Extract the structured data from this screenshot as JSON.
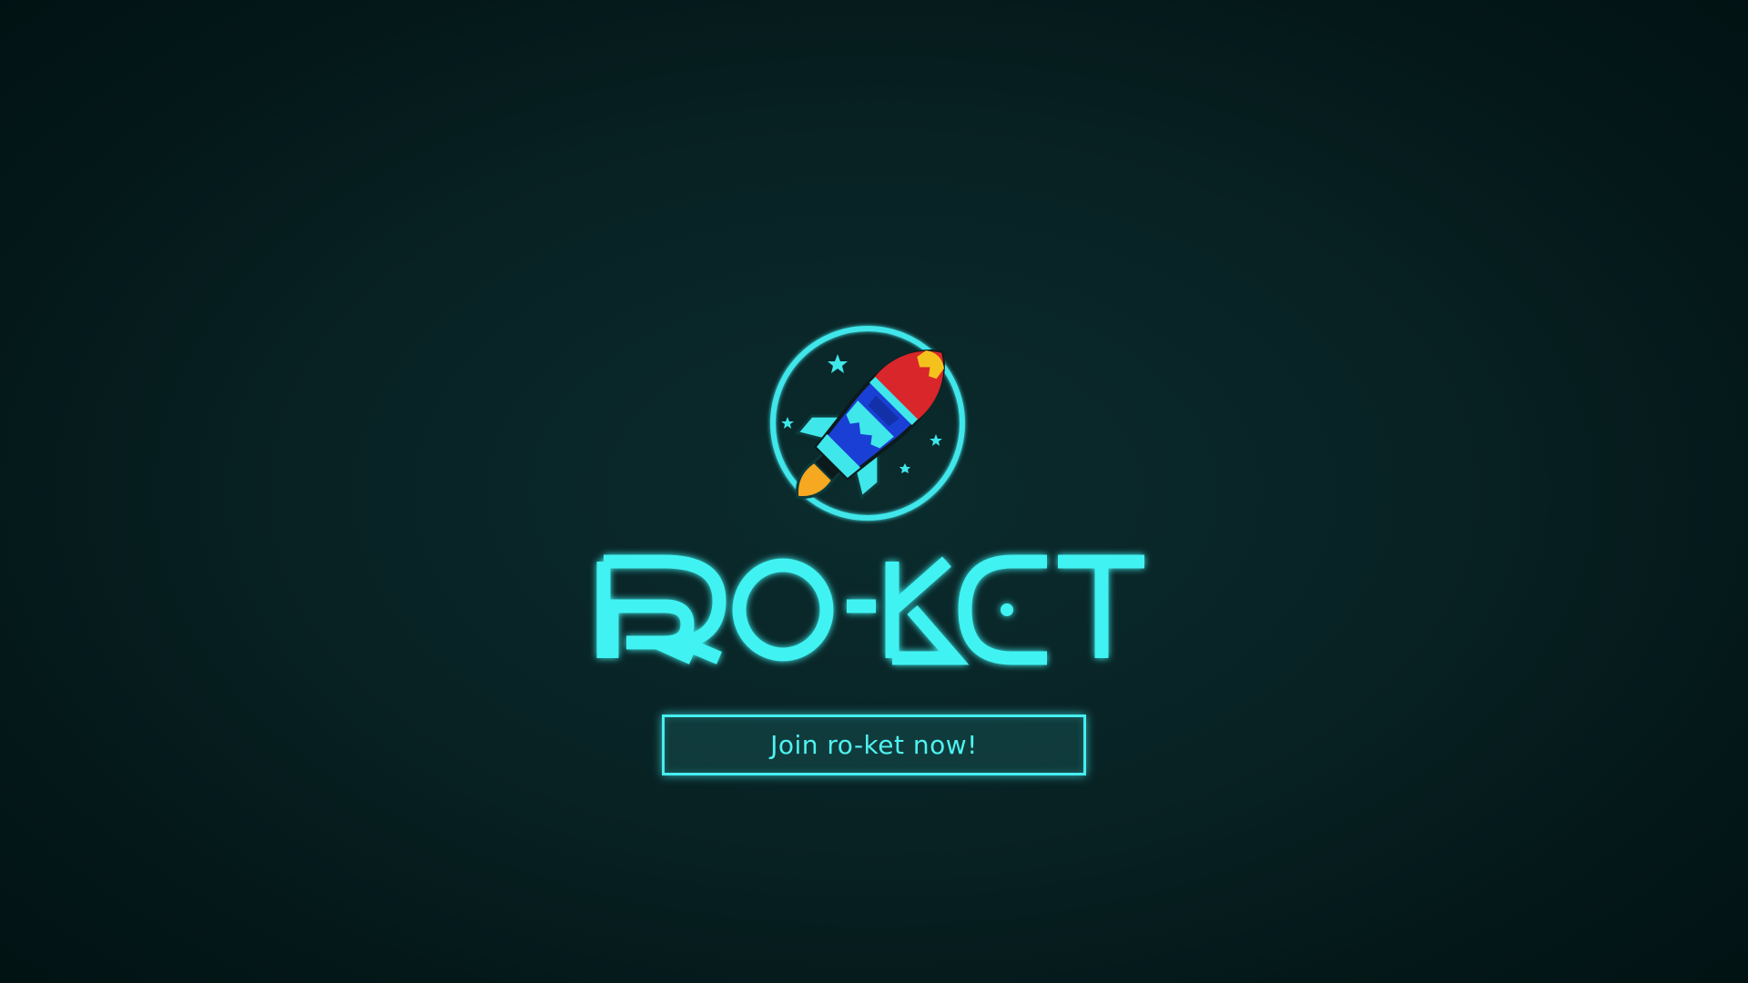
{
  "brand": {
    "name": "RO-KET",
    "logo_icon": "rocket-icon"
  },
  "cta": {
    "label": "Join ro-ket now!"
  },
  "colors": {
    "background": "#082224",
    "accent": "#46eef0",
    "rocket_red": "#d8262b",
    "rocket_blue": "#1a3fd4",
    "rocket_yellow": "#f4c21c",
    "flame": "#f6a821"
  }
}
